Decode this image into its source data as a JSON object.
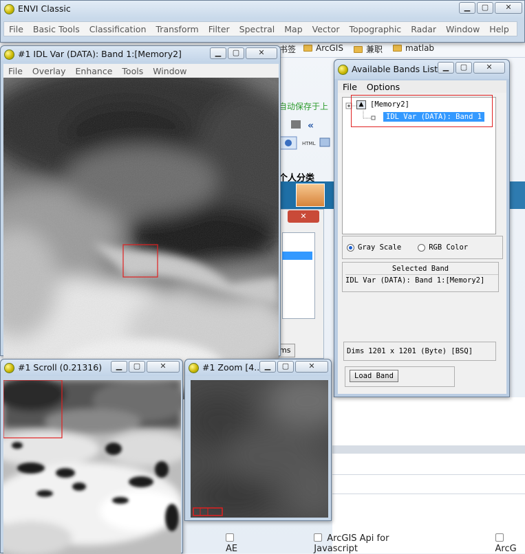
{
  "main_window": {
    "title": "ENVI Classic",
    "menu": [
      "File",
      "Basic Tools",
      "Classification",
      "Transform",
      "Filter",
      "Spectral",
      "Map",
      "Vector",
      "Topographic",
      "Radar",
      "Window",
      "Help"
    ]
  },
  "image_window": {
    "title": "#1 IDL Var (DATA): Band 1:[Memory2]",
    "menu": [
      "File",
      "Overlay",
      "Enhance",
      "Tools",
      "Window"
    ]
  },
  "bands_window": {
    "title": "Available Bands List",
    "menu": [
      "File",
      "Options"
    ],
    "tree_root": "[Memory2]",
    "tree_child": "IDL Var (DATA): Band 1",
    "gray_scale_label": "Gray Scale",
    "rgb_color_label": "RGB Color",
    "selected_band_heading": "Selected Band",
    "selected_band_value": "IDL Var (DATA): Band 1:[Memory2]",
    "dims_label": "Dims",
    "dims_value": "1201 x 1201 (Byte) [BSQ]",
    "load_band_label": "Load Band"
  },
  "scroll_window": {
    "title": "#1 Scroll (0.21316)"
  },
  "zoom_window": {
    "title": "#1 Zoom [4..."
  },
  "background_page": {
    "bookmarks": [
      "书签",
      "ArcGIS",
      "兼职",
      "matlab"
    ],
    "green_notice": "自动保存于上",
    "personal_category": "个人分类",
    "dialog_button_fragment": "ms",
    "checkboxes": [
      "AE",
      "ArcGIS Api for Javascript",
      "ArcG"
    ]
  },
  "colors": {
    "selection_highlight": "#3399ff",
    "annotation_red": "#e02020",
    "window_frame": "#c5d6e8"
  }
}
